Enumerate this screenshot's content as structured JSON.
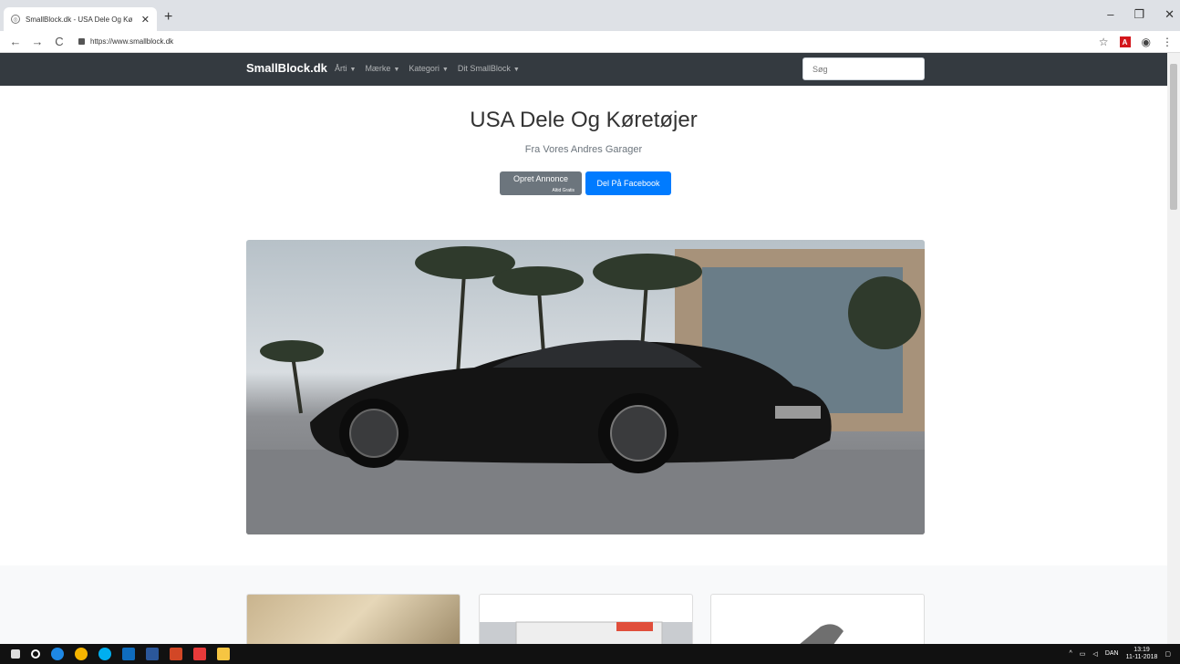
{
  "browser": {
    "tab_title": "SmallBlock.dk - USA Dele Og Kø",
    "url": "https://www.smallblock.dk",
    "close_glyph": "✕",
    "newtab_glyph": "+"
  },
  "site": {
    "brand": "SmallBlock.dk",
    "nav": [
      {
        "label": "Årti"
      },
      {
        "label": "Mærke"
      },
      {
        "label": "Kategori"
      },
      {
        "label": "Dit SmallBlock"
      }
    ],
    "search_placeholder": "Søg",
    "hero": {
      "title": "USA Dele Og Køretøjer",
      "subtitle": "Fra Vores Andres Garager",
      "btn_create": "Opret Annonce",
      "btn_create_small": "Altid Gratis",
      "btn_share": "Del På Facebook"
    }
  },
  "taskbar": {
    "lang": "DAN",
    "time": "13:19",
    "date": "11-11-2018"
  },
  "colors": {
    "navbar": "#343a40",
    "primary": "#007bff",
    "secondary": "#6c757d"
  }
}
